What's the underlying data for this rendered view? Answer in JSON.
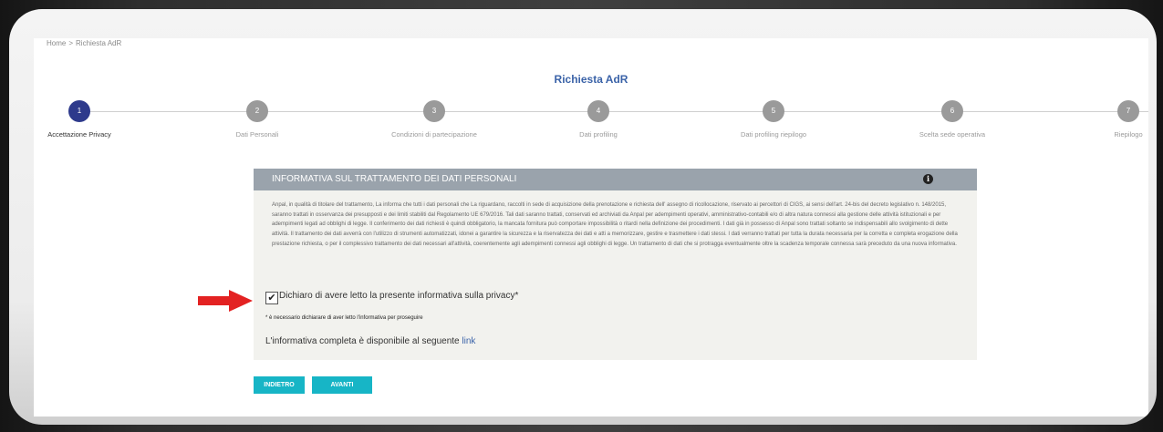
{
  "breadcrumb": {
    "home": "Home",
    "separator": ">",
    "current": "Richiesta AdR"
  },
  "page_title": "Richiesta AdR",
  "steps": [
    {
      "number": "1",
      "label": "Accettazione Privacy",
      "active": true
    },
    {
      "number": "2",
      "label": "Dati Personali",
      "active": false
    },
    {
      "number": "3",
      "label": "Condizioni di partecipazione",
      "active": false
    },
    {
      "number": "4",
      "label": "Dati profiling",
      "active": false
    },
    {
      "number": "5",
      "label": "Dati profiling riepilogo",
      "active": false
    },
    {
      "number": "6",
      "label": "Scelta sede operativa",
      "active": false
    },
    {
      "number": "7",
      "label": "Riepilogo",
      "active": false
    }
  ],
  "panel": {
    "title": "INFORMATIVA SUL TRATTAMENTO DEI DATI PERSONALI",
    "body": "Anpal, in qualità di titolare del trattamento, La informa che tutti i dati personali che La riguardano, raccolti in sede di acquisizione della prenotazione e richiesta dell' assegno di ricollocazione, riservato ai percettori di CIGS, ai sensi dell'art. 24-bis del decreto legislativo n. 148/2015, saranno trattati in osservanza dei presupposti e dei limiti stabiliti dal Regolamento UE 679/2016. Tali dati saranno trattati, conservati ed archiviati da Anpal per adempimenti operativi, amministrativo-contabili e/o di altra natura connessi alla gestione delle attività istituzionali e per adempimenti legati ad obblighi di legge. Il conferimento dei dati richiesti è quindi obbligatorio, la mancata fornitura può comportare impossibilità o ritardi nella definizione dei procedimenti. I dati già in possesso di Anpal sono trattati soltanto se indispensabili allo svolgimento di dette attività. Il trattamento dei dati avverrà con l'utilizzo di strumenti automatizzati, idonei a garantire la sicurezza e la riservatezza dei dati e atti a memorizzare, gestire e trasmettere i dati stessi. I dati verranno trattati per tutta la durata necessaria per la corretta e completa erogazione della prestazione richiesta, o per il complessivo trattamento dei dati necessari all'attività, coerentemente agli adempimenti connessi agli obblighi di legge. Un trattamento di dati che si protragga eventualmente oltre la scadenza temporale connessa sarà preceduto da una nuova informativa."
  },
  "consent": {
    "checked": true,
    "label": "Dichiaro di avere letto la presente informativa sulla privacy*"
  },
  "required_note": "* è necessario dichiarare di aver letto l'informativa per proseguire",
  "full_info": {
    "text": "L'informativa completa è disponibile al seguente",
    "link_label": "link"
  },
  "buttons": {
    "back": "INDIETRO",
    "next": "AVANTI"
  },
  "colors": {
    "accent": "#17b5c6",
    "active_step": "#2e3a8c",
    "title": "#3b63a8",
    "arrow": "#e32222",
    "panel_header": "#9aa3ac"
  },
  "icons": {
    "info": "info-circle-icon",
    "checkbox": "checkmark-icon",
    "pointer": "red-arrow-icon"
  }
}
